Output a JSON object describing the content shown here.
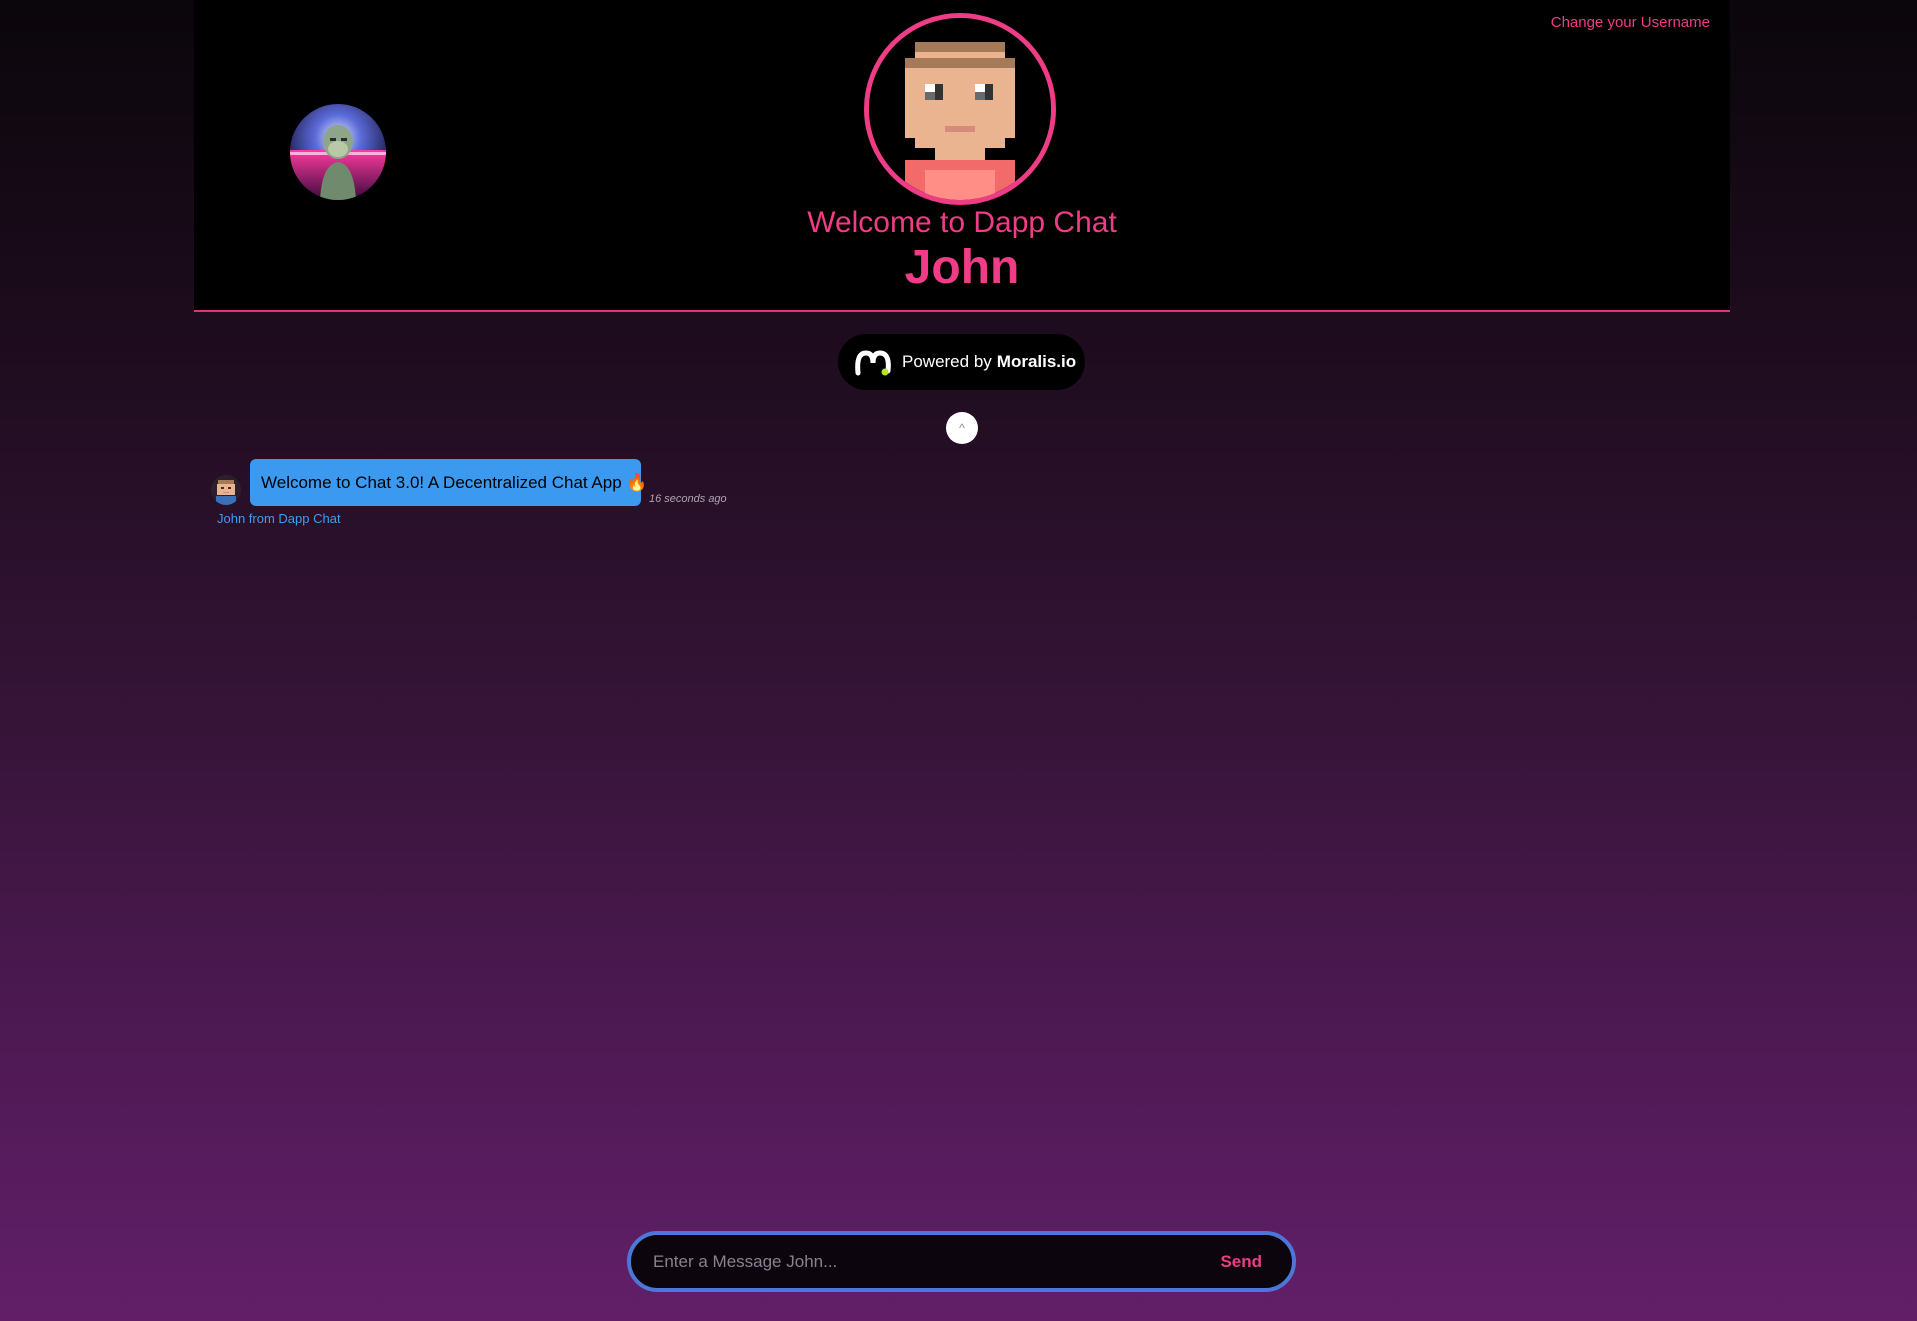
{
  "header": {
    "change_username": "Change your Username",
    "welcome": "Welcome to Dapp Chat",
    "username": "John",
    "accent_color": "#ee3c86"
  },
  "badge": {
    "prefix": "Powered by",
    "brand": "Moralis.io"
  },
  "scroll_up_label": "^",
  "messages": [
    {
      "text": "Welcome to Chat 3.0! A Decentralized Chat App 🔥",
      "time": "16 seconds ago",
      "sender": "John from Dapp Chat",
      "bubble_color": "#3b9af0"
    }
  ],
  "composer": {
    "placeholder": "Enter a Message John...",
    "send_label": "Send"
  }
}
